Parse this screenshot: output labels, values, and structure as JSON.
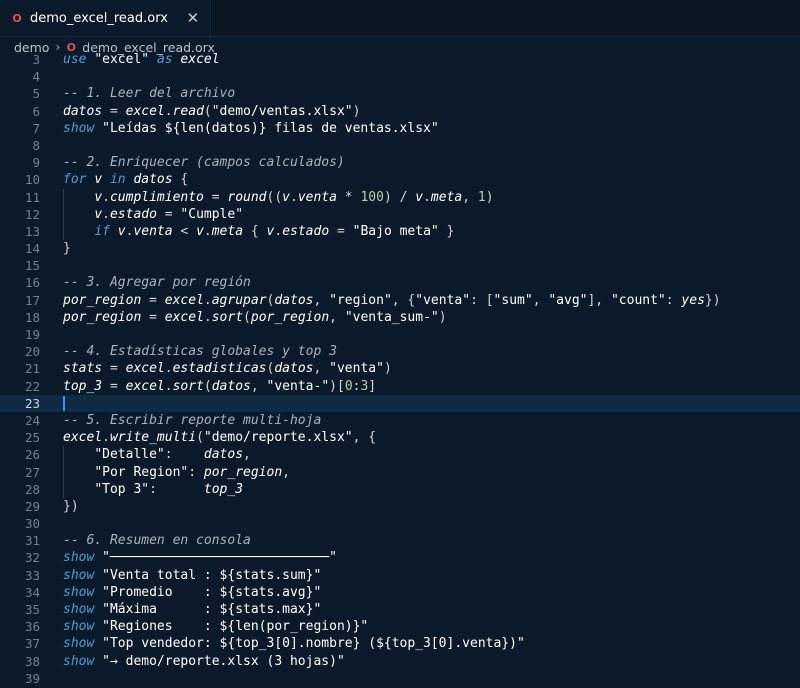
{
  "tab": {
    "file_icon": "O",
    "title": "demo_excel_read.orx",
    "close": "✕"
  },
  "breadcrumb": {
    "folder": "demo",
    "separator": "›",
    "file_icon": "O",
    "file": "demo_excel_read.orx"
  },
  "cursor_line": 23,
  "lines": [
    {
      "n": "3",
      "text": "use \"excel\" as excel"
    },
    {
      "n": "4",
      "text": ""
    },
    {
      "n": "5",
      "text": "-- 1. Leer del archivo"
    },
    {
      "n": "6",
      "text": "datos = excel.read(\"demo/ventas.xlsx\")"
    },
    {
      "n": "7",
      "text": "show \"Leídas ${len(datos)} filas de ventas.xlsx\""
    },
    {
      "n": "8",
      "text": ""
    },
    {
      "n": "9",
      "text": "-- 2. Enriquecer (campos calculados)"
    },
    {
      "n": "10",
      "text": "for v in datos {"
    },
    {
      "n": "11",
      "text": "    v.cumplimiento = round((v.venta * 100) / v.meta, 1)"
    },
    {
      "n": "12",
      "text": "    v.estado = \"Cumple\""
    },
    {
      "n": "13",
      "text": "    if v.venta < v.meta { v.estado = \"Bajo meta\" }"
    },
    {
      "n": "14",
      "text": "}"
    },
    {
      "n": "15",
      "text": ""
    },
    {
      "n": "16",
      "text": "-- 3. Agregar por región"
    },
    {
      "n": "17",
      "text": "por_region = excel.agrupar(datos, \"region\", {\"venta\": [\"sum\", \"avg\"], \"count\": yes})"
    },
    {
      "n": "18",
      "text": "por_region = excel.sort(por_region, \"venta_sum-\")"
    },
    {
      "n": "19",
      "text": ""
    },
    {
      "n": "20",
      "text": "-- 4. Estadísticas globales y top 3"
    },
    {
      "n": "21",
      "text": "stats = excel.estadisticas(datos, \"venta\")"
    },
    {
      "n": "22",
      "text": "top_3 = excel.sort(datos, \"venta-\")[0:3]"
    },
    {
      "n": "23",
      "text": ""
    },
    {
      "n": "24",
      "text": "-- 5. Escribir reporte multi-hoja"
    },
    {
      "n": "25",
      "text": "excel.write_multi(\"demo/reporte.xlsx\", {"
    },
    {
      "n": "26",
      "text": "    \"Detalle\":    datos,"
    },
    {
      "n": "27",
      "text": "    \"Por Region\": por_region,"
    },
    {
      "n": "28",
      "text": "    \"Top 3\":      top_3"
    },
    {
      "n": "29",
      "text": "})"
    },
    {
      "n": "30",
      "text": ""
    },
    {
      "n": "31",
      "text": "-- 6. Resumen en consola"
    },
    {
      "n": "32",
      "text": "show \"────────────────────────────\""
    },
    {
      "n": "33",
      "text": "show \"Venta total : ${stats.sum}\""
    },
    {
      "n": "34",
      "text": "show \"Promedio    : ${stats.avg}\""
    },
    {
      "n": "35",
      "text": "show \"Máxima      : ${stats.max}\""
    },
    {
      "n": "36",
      "text": "show \"Regiones    : ${len(por_region)}\""
    },
    {
      "n": "37",
      "text": "show \"Top vendedor: ${top_3[0].nombre} (${top_3[0].venta})\""
    },
    {
      "n": "38",
      "text": "show \"→ demo/reporte.xlsx (3 hojas)\""
    },
    {
      "n": "39",
      "text": ""
    }
  ]
}
